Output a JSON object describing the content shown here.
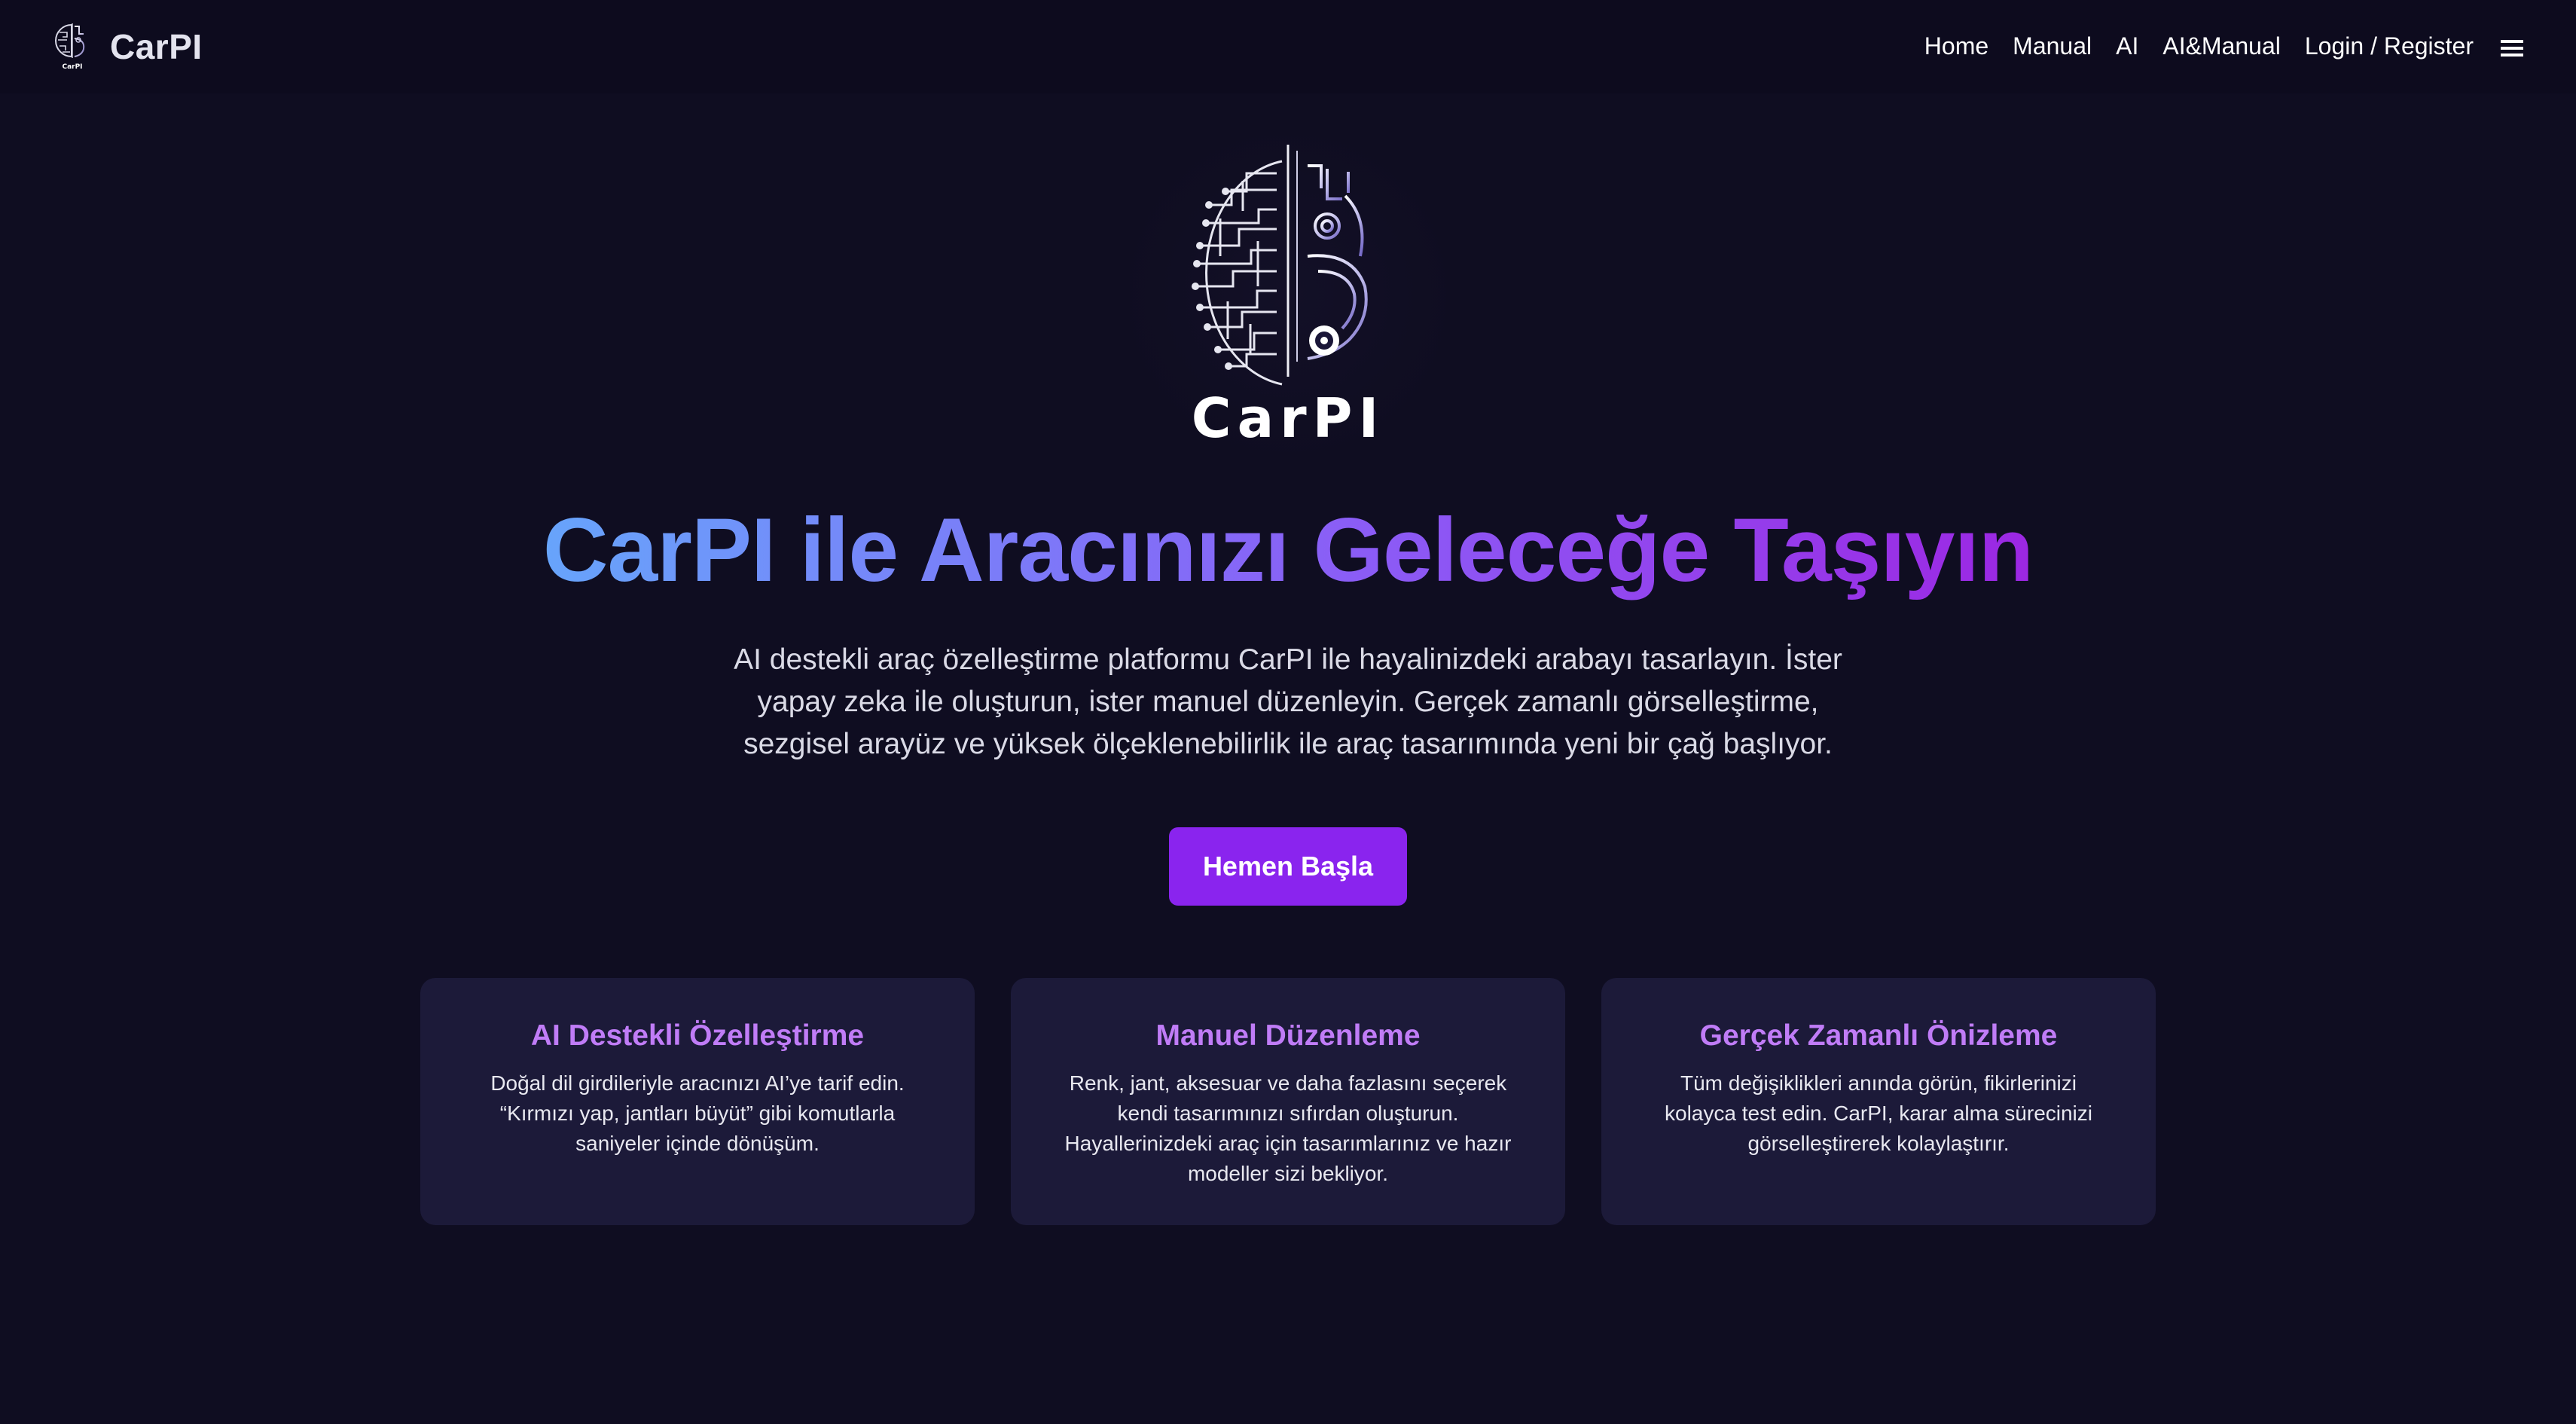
{
  "header": {
    "brand_name": "CarPI",
    "nav": [
      {
        "label": "Home"
      },
      {
        "label": "Manual"
      },
      {
        "label": "AI"
      },
      {
        "label": "AI&Manual"
      },
      {
        "label": "Login / Register"
      }
    ],
    "menu_icon": "hamburger-menu-icon"
  },
  "hero": {
    "logo_text": "CarPI",
    "title": "CarPI ile Aracınızı Geleceğe Taşıyın",
    "description": "AI destekli araç özelleştirme platformu CarPI ile hayalinizdeki arabayı tasarlayın. İster yapay zeka ile oluşturun, ister manuel düzenleyin. Gerçek zamanlı görselleştirme, sezgisel arayüz ve yüksek ölçeklenebilirlik ile araç tasarımında yeni bir çağ başlıyor.",
    "cta_label": "Hemen Başla"
  },
  "features": [
    {
      "title": "AI Destekli Özelleştirme",
      "text": "Doğal dil girdileriyle aracınızı AI’ye tarif edin. “Kırmızı yap, jantları büyüt” gibi komutlarla saniyeler içinde dönüşüm."
    },
    {
      "title": "Manuel Düzenleme",
      "text": "Renk, jant, aksesuar ve daha fazlasını seçerek kendi tasarımınızı sıfırdan oluşturun. Hayallerinizdeki araç için tasarımlarınız ve hazır modeller sizi bekliyor."
    },
    {
      "title": "Gerçek Zamanlı Önizleme",
      "text": "Tüm değişiklikleri anında görün, fikirlerinizi kolayca test edin. CarPI, karar alma sürecinizi görselleştirerek kolaylaştırır."
    }
  ],
  "colors": {
    "background": "#0f0d21",
    "navbar": "#0d0b1e",
    "card": "#1c1a39",
    "accent_purple": "#8a24ee",
    "card_title": "#c07cf7",
    "gradient_start": "#67a4fb",
    "gradient_end": "#9c27e3"
  }
}
